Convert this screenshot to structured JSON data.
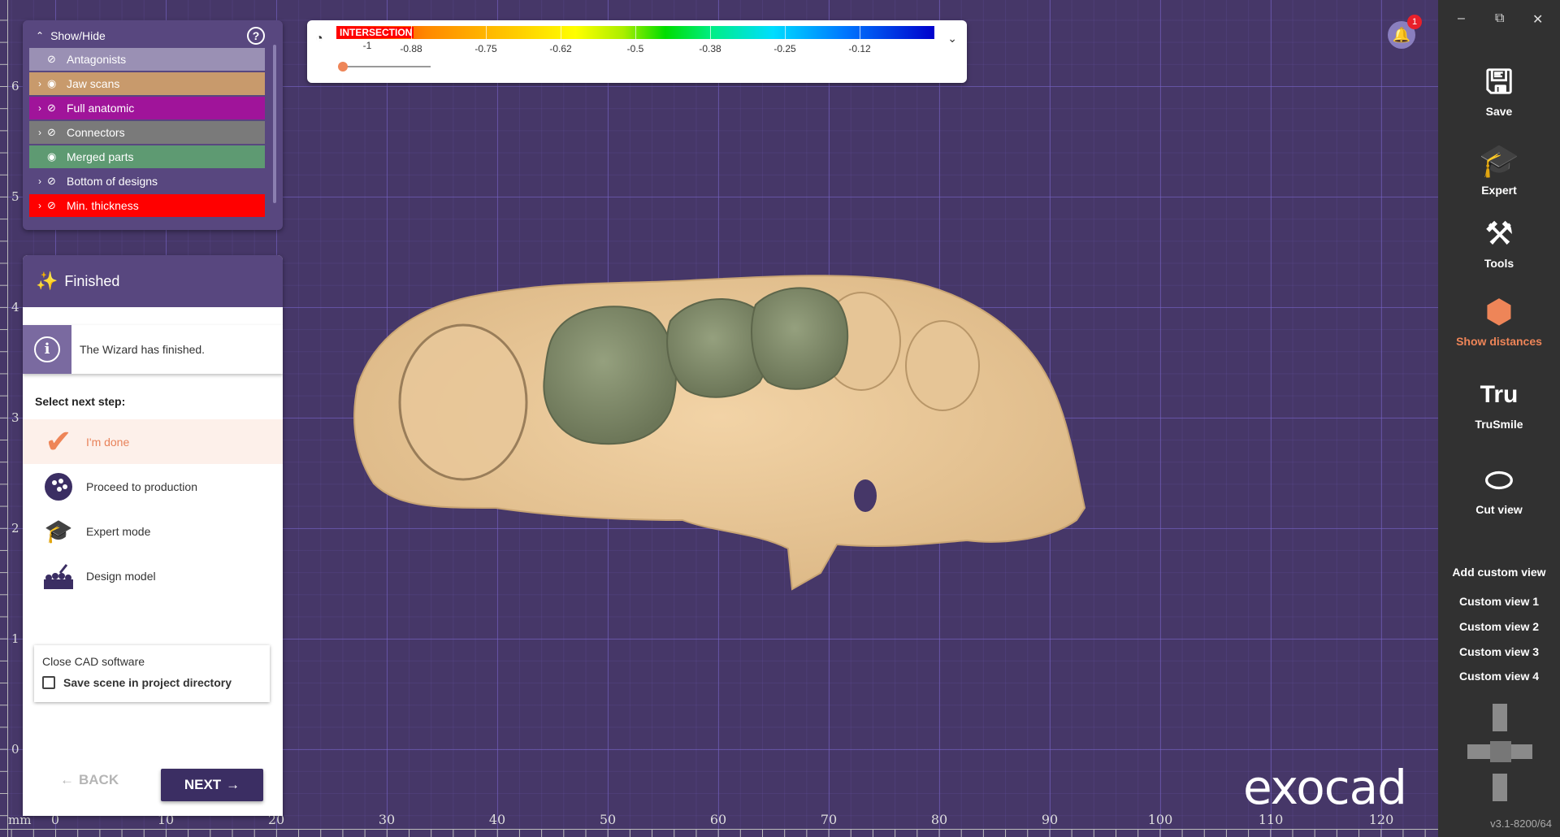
{
  "viewport": {
    "y_ticks": [
      "6",
      "5",
      "4",
      "3",
      "2",
      "1",
      "0"
    ],
    "x_ticks": [
      "0",
      "10",
      "20",
      "30",
      "40",
      "50",
      "60",
      "70",
      "80",
      "90",
      "100",
      "110",
      "120"
    ],
    "unit_label": "mm",
    "logo": "exocad"
  },
  "show_hide": {
    "title": "Show/Hide",
    "help_icon": "question-circle-icon",
    "items": [
      {
        "label": "Antagonists",
        "color": "#9a90b4",
        "visible": false,
        "expandable": false
      },
      {
        "label": "Jaw scans",
        "color": "#c89a6c",
        "visible": true,
        "expandable": true
      },
      {
        "label": "Full anatomic",
        "color": "#a0149a",
        "visible": false,
        "expandable": true
      },
      {
        "label": "Connectors",
        "color": "#7a7a7a",
        "visible": false,
        "expandable": true
      },
      {
        "label": "Merged parts",
        "color": "#5e9a72",
        "visible": true,
        "expandable": false
      },
      {
        "label": "Bottom of designs",
        "color": "#58477f",
        "visible": false,
        "expandable": true
      },
      {
        "label": "Min. thickness",
        "color": "#ff0000",
        "visible": false,
        "expandable": true
      }
    ]
  },
  "wizard": {
    "title": "Finished",
    "info_message": "The Wizard has finished.",
    "step_prompt": "Select next step:",
    "options": [
      {
        "label": "I'm done",
        "icon": "checkmark-icon",
        "selected": true
      },
      {
        "label": "Proceed to production",
        "icon": "production-icon",
        "selected": false
      },
      {
        "label": "Expert mode",
        "icon": "graduation-cap-icon",
        "selected": false
      },
      {
        "label": "Design model",
        "icon": "model-icon",
        "selected": false
      }
    ],
    "close_section": {
      "title": "Close CAD software",
      "checkbox_label": "Save scene in project directory",
      "checked": false
    },
    "back_label": "BACK",
    "next_label": "NEXT"
  },
  "color_scale": {
    "label": "INTERSECTION",
    "ticks": [
      "-1",
      "-0.88",
      "-0.75",
      "-0.62",
      "-0.5",
      "-0.38",
      "-0.25",
      "-0.12"
    ],
    "slider_value": 0
  },
  "notifications": {
    "count": "1"
  },
  "sidebar": {
    "tools": [
      {
        "label": "Save",
        "icon": "save-icon",
        "active": false
      },
      {
        "label": "Expert",
        "icon": "graduation-cap-icon",
        "active": false
      },
      {
        "label": "Tools",
        "icon": "tools-icon",
        "active": false
      },
      {
        "label": "Show distances",
        "icon": "show-distances-icon",
        "active": true
      },
      {
        "label": "TruSmile",
        "icon": "trusmile-icon",
        "active": false
      },
      {
        "label": "Cut view",
        "icon": "cut-view-icon",
        "active": false
      }
    ],
    "add_custom_view": "Add custom view",
    "custom_views": [
      "Custom view 1",
      "Custom view 2",
      "Custom view 3",
      "Custom view 4"
    ],
    "version": "v3.1-8200/64"
  }
}
